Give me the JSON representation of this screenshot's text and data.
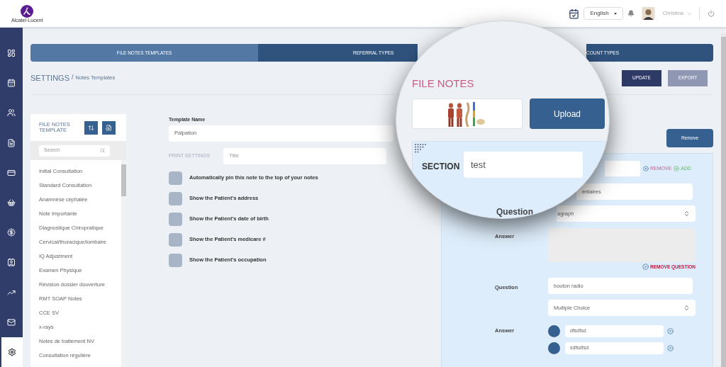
{
  "header": {
    "logo_text": "Alcatel·Lucent",
    "language": "English",
    "user_name": "Christina"
  },
  "sidebar": {
    "items": [
      {
        "kind": "dashboard",
        "selected": false
      },
      {
        "kind": "calendar",
        "selected": false
      },
      {
        "kind": "users",
        "selected": false
      },
      {
        "kind": "notes",
        "selected": false
      },
      {
        "kind": "card",
        "selected": false
      },
      {
        "kind": "basket",
        "selected": false
      },
      {
        "kind": "money",
        "selected": false
      },
      {
        "kind": "contact",
        "selected": false
      },
      {
        "kind": "chart",
        "selected": false
      },
      {
        "kind": "mail",
        "selected": false
      },
      {
        "kind": "settings",
        "selected": true
      }
    ]
  },
  "tabs": [
    {
      "label": "FILE NOTES TEMPLATES",
      "selected": true
    },
    {
      "label": "REFERRAL TYPES",
      "selected": false
    },
    {
      "label": "COUNT TYPES",
      "selected": false
    }
  ],
  "breadcrumb": {
    "section": "SETTINGS",
    "separator": "/",
    "page": "Notes Templates"
  },
  "actions": [
    {
      "label": "UPDATE",
      "disabled": false
    },
    {
      "label": "EXPORT",
      "disabled": true
    }
  ],
  "templates_panel": {
    "title": "FILE NOTES TEMPLATE",
    "search_placeholder": "Search",
    "items": [
      "Initial Consultation",
      "Standard Consultation",
      "Anamnèse céphalée",
      "Note Importante",
      "Diagnostique Chiropratique",
      "Cervical/thoracique/lombaire",
      "IQ Adjustment",
      "Examen Physique",
      "Révision dossier douverture",
      "RMT SOAP Notes",
      "CCE SV",
      "x-rays",
      "Notes de traitement NV",
      "Consultation régulière"
    ]
  },
  "form": {
    "template_name_label": "Template Name",
    "template_name": "Palpation",
    "print_settings_label": "PRINT SETTINGS",
    "title_placeholder": "Title",
    "options": [
      {
        "label": "Automatically pin this note to the top of your notes",
        "checked": false
      },
      {
        "label": "Show the Patient's address",
        "checked": false
      },
      {
        "label": "Show the Patient's date of birth",
        "checked": false
      },
      {
        "label": "Show the Patient's medicare #",
        "checked": false
      },
      {
        "label": "Show the Patient's occupation",
        "checked": false
      }
    ]
  },
  "section_panel": {
    "remove_button": "Remove",
    "remove_label": "REMOVE",
    "add_label": "ADD",
    "questions": [
      {
        "kind": "paragraph",
        "value": "entaires",
        "type": "agraph",
        "answer_label": "Answer",
        "remove_label": "REMOVE QUESTION"
      },
      {
        "kind": "multiple_choice",
        "question_label": "Question",
        "value": "bouton radio",
        "type": "Multiple Choice",
        "answer_label": "Answer",
        "options": [
          "dfsdfsd",
          "sdfsdfsd"
        ]
      }
    ]
  },
  "magnifier": {
    "title": "FILE NOTES",
    "upload_button": "Upload",
    "section_label": "SECTION",
    "section_value": "test",
    "question_label": "Question"
  }
}
